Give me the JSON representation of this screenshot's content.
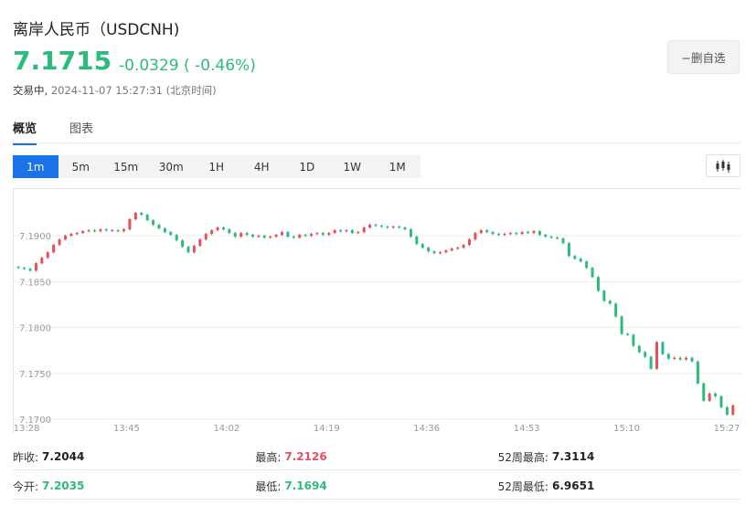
{
  "header": {
    "title": "离岸人民币（USDCNH)",
    "price": "7.1715",
    "change": "-0.0329 ( -0.46%)",
    "status_trading": "交易中,",
    "status_time": "2024-11-07 15:27:31 (北京时间)",
    "remove_button": "−删自选"
  },
  "tabs": [
    {
      "label": "概览",
      "active": true
    },
    {
      "label": "图表",
      "active": false
    }
  ],
  "periods": [
    "1m",
    "5m",
    "15m",
    "30m",
    "1H",
    "4H",
    "1D",
    "1W",
    "1M"
  ],
  "active_period": "1m",
  "colors": {
    "up": "#e5505a",
    "down": "#2dbb7c",
    "accent": "#1a73e8"
  },
  "chart_data": {
    "type": "candlestick",
    "y_ticks": [
      "7.1900",
      "7.1850",
      "7.1800",
      "7.1750",
      "7.1700"
    ],
    "x_ticks": [
      "13:28",
      "13:45",
      "14:02",
      "14:19",
      "14:36",
      "14:53",
      "15:10",
      "15:27"
    ],
    "ylim": [
      7.1698,
      7.1935
    ],
    "grid": "horizontal",
    "close_series": [
      7.1865,
      7.1864,
      7.1862,
      7.187,
      7.1876,
      7.1882,
      7.189,
      7.1896,
      7.19,
      7.1902,
      7.1903,
      7.1905,
      7.1906,
      7.1905,
      7.1907,
      7.1906,
      7.1906,
      7.1905,
      7.1907,
      7.1918,
      7.1925,
      7.1923,
      7.1917,
      7.1912,
      7.1908,
      7.1904,
      7.1901,
      7.1895,
      7.1888,
      7.1882,
      7.1889,
      7.1896,
      7.1902,
      7.1906,
      7.1909,
      7.1907,
      7.1903,
      7.1899,
      7.1903,
      7.1901,
      7.1899,
      7.19,
      7.1898,
      7.1899,
      7.1901,
      7.1904,
      7.1899,
      7.1898,
      7.1901,
      7.19,
      7.1902,
      7.1903,
      7.1901,
      7.1903,
      7.1906,
      7.1905,
      7.1906,
      7.1903,
      7.1904,
      7.1909,
      7.1912,
      7.1911,
      7.191,
      7.1909,
      7.191,
      7.1909,
      7.1907,
      7.1899,
      7.1891,
      7.1887,
      7.1883,
      7.1881,
      7.1882,
      7.1884,
      7.1886,
      7.1887,
      7.189,
      7.1896,
      7.1903,
      7.1906,
      7.1904,
      7.1902,
      7.1901,
      7.1902,
      7.1903,
      7.1902,
      7.1904,
      7.1903,
      7.1905,
      7.1901,
      7.1899,
      7.1898,
      7.1897,
      7.1892,
      7.1878,
      7.1875,
      7.1872,
      7.1865,
      7.1855,
      7.184,
      7.1829,
      7.1826,
      7.1812,
      7.1793,
      7.1792,
      7.178,
      7.1773,
      7.1768,
      7.1755,
      7.1784,
      7.1771,
      7.1766,
      7.1767,
      7.1765,
      7.1767,
      7.1763,
      7.1739,
      7.172,
      7.1728,
      7.1725,
      7.1713,
      7.1705,
      7.1715
    ]
  },
  "stats": [
    [
      {
        "label": "昨收:",
        "value": "7.2044",
        "color": "default"
      },
      {
        "label": "最高:",
        "value": "7.2126",
        "color": "red"
      },
      {
        "label": "52周最高:",
        "value": "7.3114",
        "color": "default"
      }
    ],
    [
      {
        "label": "今开:",
        "value": "7.2035",
        "color": "green"
      },
      {
        "label": "最低:",
        "value": "7.1694",
        "color": "green"
      },
      {
        "label": "52周最低:",
        "value": "6.9651",
        "color": "default"
      }
    ]
  ]
}
